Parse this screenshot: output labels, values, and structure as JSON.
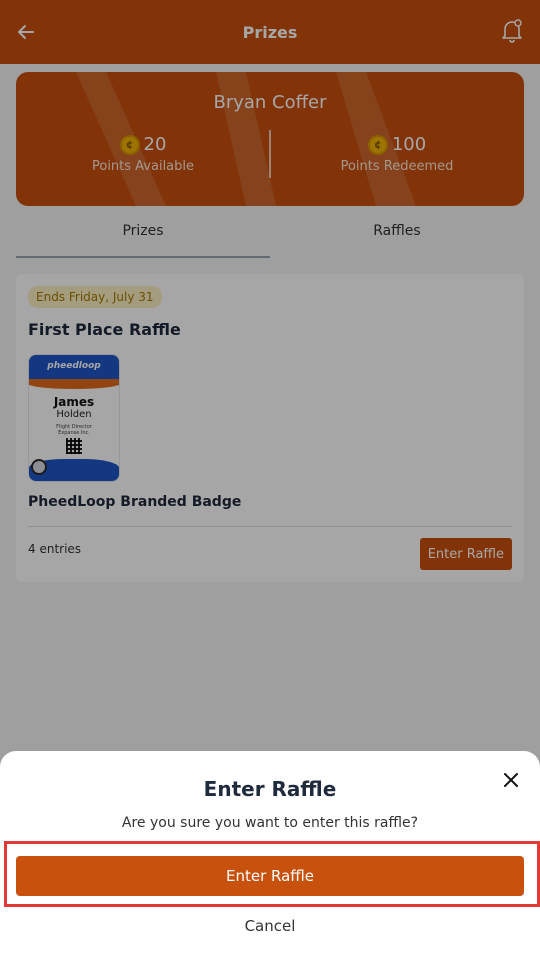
{
  "header": {
    "title": "Prizes",
    "back_icon": "arrow-left-icon",
    "bell_icon": "bell-icon"
  },
  "points_card": {
    "user_name": "Bryan Coffer",
    "available": {
      "value": "20",
      "label": "Points Available"
    },
    "redeemed": {
      "value": "100",
      "label": "Points Redeemed"
    }
  },
  "tabs": [
    {
      "label": "Prizes",
      "active": true
    },
    {
      "label": "Raffles",
      "active": false
    }
  ],
  "raffle": {
    "ends_label": "Ends Friday, July 31",
    "title": "First Place Raffle",
    "badge_image": {
      "logo_text": "pheedloop",
      "first_name": "James",
      "last_name": "Holden",
      "role_line1": "Flight Director",
      "role_line2": "Expanse Inc."
    },
    "prize_name": "PheedLoop Branded Badge",
    "entries": "4 entries",
    "enter_button": "Enter Raffle"
  },
  "sheet": {
    "title": "Enter Raffle",
    "message": "Are you sure you want to enter this raffle?",
    "confirm_label": "Enter Raffle",
    "cancel_label": "Cancel",
    "close_icon": "close-icon"
  },
  "colors": {
    "brand": "#c8510d",
    "highlight": "#e53935",
    "coin": "#f1b400"
  }
}
